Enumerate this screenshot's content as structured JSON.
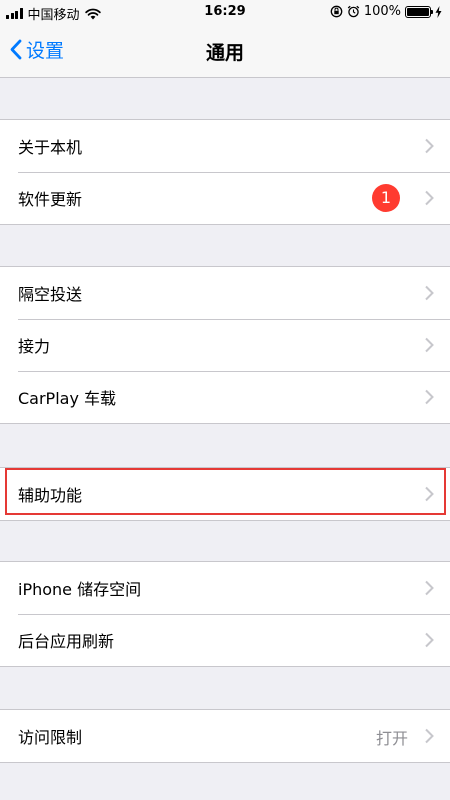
{
  "status_bar": {
    "carrier": "中国移动",
    "time": "16:29",
    "battery": "100%",
    "battery_level": 1.0
  },
  "nav": {
    "back_label": "设置",
    "title": "通用"
  },
  "groups": [
    {
      "items": [
        {
          "label": "关于本机"
        },
        {
          "label": "软件更新",
          "badge": "1"
        }
      ]
    },
    {
      "items": [
        {
          "label": "隔空投送"
        },
        {
          "label": "接力"
        },
        {
          "label": "CarPlay 车载"
        }
      ]
    },
    {
      "items": [
        {
          "label": "辅助功能",
          "highlighted": true
        }
      ]
    },
    {
      "items": [
        {
          "label": "iPhone 储存空间"
        },
        {
          "label": "后台应用刷新"
        }
      ]
    },
    {
      "items": [
        {
          "label": "访问限制",
          "value": "打开"
        }
      ]
    }
  ],
  "colors": {
    "accent": "#007aff",
    "badge": "#ff3b30",
    "highlight_border": "#e53935",
    "background": "#efeff4"
  }
}
